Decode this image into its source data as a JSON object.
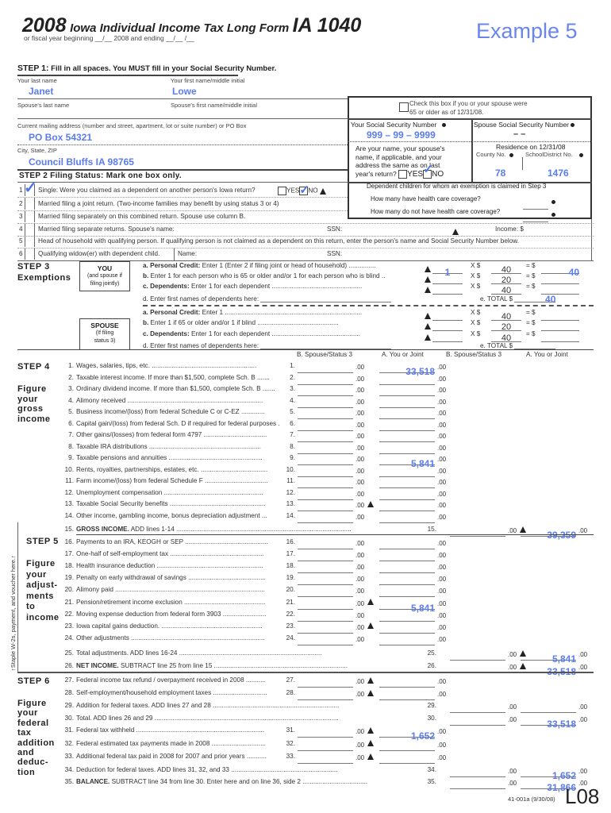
{
  "header": {
    "year": "2008",
    "title": "Iowa Individual Income Tax Long Form",
    "form": "IA 1040",
    "fiscal": "or fiscal year beginning __/__ 2008 and ending __/__ /__",
    "example": "Example 5"
  },
  "step1": {
    "title": "STEP 1:",
    "subtitle": "Fill in all spaces. You MUST fill in your Social Security Number.",
    "last_name_label": "Your last name",
    "last_name": "Janet",
    "first_name_label": "Your first name/middle initial",
    "first_name": "Lowe",
    "spouse_last_label": "Spouse's last name",
    "spouse_first_label": "Spouse's first name/middle initial",
    "address_label": "Current mailing address (number and street, apartment, lot or suite number) or PO Box",
    "address": "PO Box 54321",
    "city_label": "City, State, ZIP",
    "city": "Council Bluffs IA  98765",
    "age65_label_1": "Check this box if you or your spouse were",
    "age65_label_2": "65 or older as of 12/31/08.",
    "ssn_label": "Your Social Security Number",
    "ssn": "999 –  99  – 9999",
    "spouse_ssn_label": "Spouse Social Security Number",
    "spouse_ssn": "–        –",
    "same_q_1": "Are your name, your spouse's",
    "same_q_2": "name, if applicable, and your",
    "same_q_3": "address the same as on last",
    "same_q_4": "year's return?",
    "yes": "YES",
    "no": "NO",
    "residence_label": "Residence on 12/31/08",
    "county_label": "County No.",
    "school_label": "SchoolDistrict No.",
    "county": "78",
    "school": "1476",
    "dep_label": "Dependent children for whom an exemption is claimed in Step 3",
    "dep_q1": "How many have health care coverage?",
    "dep_q2": "How many do not have health care coverage?"
  },
  "step2": {
    "title": "STEP 2 Filing Status: Mark one box only.",
    "rows": [
      {
        "num": "1",
        "text": "Single: Were you claimed as a dependent on another person's Iowa return?",
        "checked": true
      },
      {
        "num": "2",
        "text": "Married filing a joint return. (Two-income families may benefit by using status 3 or 4)",
        "checked": false
      },
      {
        "num": "3",
        "text": "Married filing separately on this combined return. Spouse use column B.",
        "checked": false
      },
      {
        "num": "4",
        "text": "Married filing separate returns. Spouse's name:",
        "checked": false
      },
      {
        "num": "5",
        "text": "Head of household with qualifying person. If qualifying person is not claimed as a dependent on this return, enter the person's name and Social Security Number below.",
        "checked": false
      },
      {
        "num": "6",
        "text": "Qualifying widow(er) with dependent child.",
        "checked": false
      }
    ],
    "yes": "YES",
    "no": "NO",
    "ssn": "SSN:",
    "income": "Income: $",
    "name": "Name:"
  },
  "step3": {
    "title": "STEP 3",
    "subtitle": "Exemptions",
    "you_box": [
      "YOU",
      "(and spouse if",
      "filing jointly)"
    ],
    "spouse_box": [
      "SPOUSE",
      "(If filing",
      "status 3)"
    ],
    "you_rows": [
      {
        "label_b": "a. Personal Credit:",
        "label": " Enter 1 (Enter 2 if filing joint or head of household) ...............",
        "count": "1",
        "mult": "40",
        "result": "40"
      },
      {
        "label_b": "b.",
        "label": " Enter 1 for each person who is 65 or older  and/or 1 for each person who is blind ..",
        "count": "",
        "mult": "20",
        "result": ""
      },
      {
        "label_b": "c. Dependents:",
        "label": " Enter 1 for each dependent ..................................................",
        "count": "",
        "mult": "40",
        "result": ""
      }
    ],
    "you_d": "d. Enter first names of dependents here:",
    "you_total_label": "e. TOTAL $",
    "you_total": "40",
    "spouse_rows": [
      {
        "label_b": "a. Personal Credit:",
        "label": " Enter 1 ............................................................................",
        "mult": "40"
      },
      {
        "label_b": "b.",
        "label": " Enter 1 if 65 or older  and/or 1 if blind .............................................",
        "mult": "20"
      },
      {
        "label_b": "c. Dependents:",
        "label": " Enter 1 for each dependent .................................................",
        "mult": "40"
      }
    ],
    "spouse_d": "d. Enter first names of dependents here:",
    "spouse_total_label": "e. TOTAL $",
    "x": "X  $",
    "eq": "=  $"
  },
  "columns": {
    "b": "B. Spouse/Status 3",
    "a": "A. You or Joint"
  },
  "step4": {
    "title": "STEP 4",
    "subtitle": [
      "Figure",
      "your",
      "gross",
      "income"
    ],
    "lines": [
      {
        "n": "1.",
        "text": "Wages, salaries, tips, etc. ..........................................................",
        "ref": "1.",
        "b": "",
        "a": "33,518",
        "tri": false
      },
      {
        "n": "2.",
        "text": "Taxable interest income. If more than $1,500, complete Sch. B .......",
        "ref": "2.",
        "b": "",
        "a": "",
        "tri": false
      },
      {
        "n": "3.",
        "text": "Ordinary dividend income. If more than $1,500, complete Sch. B .......",
        "ref": "3.",
        "b": "",
        "a": "",
        "tri": false
      },
      {
        "n": "4.",
        "text": "Alimony received ...........................................................................",
        "ref": "4.",
        "b": "",
        "a": "",
        "tri": false
      },
      {
        "n": "5.",
        "text": "Business income/(loss) from federal Schedule C or C-EZ .............",
        "ref": "5.",
        "b": "",
        "a": "",
        "tri": false
      },
      {
        "n": "6.",
        "text": "Capital gain/(loss) from federal Sch. D if required for federal purposes .",
        "ref": "6.",
        "b": "",
        "a": "",
        "tri": false
      },
      {
        "n": "7.",
        "text": "Other gains/(losses) from federal form 4797 ...................................",
        "ref": "7.",
        "b": "",
        "a": "",
        "tri": false
      },
      {
        "n": "8.",
        "text": "Taxable IRA distributions ..............................................................",
        "ref": "8.",
        "b": "",
        "a": "",
        "tri": false
      },
      {
        "n": "9.",
        "text": "Taxable pensions and annuities ....................................................",
        "ref": "9.",
        "b": "",
        "a": "5,841",
        "tri": false
      },
      {
        "n": "10.",
        "text": "Rents, royalties, partnerships, estates, etc. .....................................",
        "ref": "10.",
        "b": "",
        "a": "",
        "tri": false
      },
      {
        "n": "11.",
        "text": "Farm income/(loss) from federal Schedule F ...................................",
        "ref": "11.",
        "b": "",
        "a": "",
        "tri": false
      },
      {
        "n": "12.",
        "text": "Unemployment compensation .......................................................",
        "ref": "12.",
        "b": "",
        "a": "",
        "tri": false
      },
      {
        "n": "13.",
        "text": "Taxable Social Security benefits .....................................................",
        "ref": "13.",
        "b": "",
        "a": "",
        "tri": true
      },
      {
        "n": "14.",
        "text": "Other income, gambling income, bonus depreciation adjustment ...",
        "ref": "14.",
        "b": "",
        "a": "",
        "tri": false
      }
    ],
    "line15": {
      "n": "15.",
      "bold": "GROSS INCOME.",
      "text": " ADD lines 1-14 .................................................................................................",
      "ref": "15.",
      "b": "",
      "a": "39,359"
    }
  },
  "staple": "Staple W-2s, payment, and voucher here.",
  "step5": {
    "title": "STEP 5",
    "subtitle": [
      "Figure",
      "your",
      "adjust-",
      "ments",
      "to",
      "income"
    ],
    "lines": [
      {
        "n": "16.",
        "text": "Payments to an IRA, KEOGH or SEP ..............................................",
        "ref": "16.",
        "b": "",
        "a": "",
        "tri": false
      },
      {
        "n": "17.",
        "text": "One-half of self-employment tax ....................................................",
        "ref": "17.",
        "b": "",
        "a": "",
        "tri": false
      },
      {
        "n": "18.",
        "text": "Health insurance deduction ...........................................................",
        "ref": "18.",
        "b": "",
        "a": "",
        "tri": false
      },
      {
        "n": "19.",
        "text": "Penalty on early withdrawal of savings ...........................................",
        "ref": "19.",
        "b": "",
        "a": "",
        "tri": false
      },
      {
        "n": "20.",
        "text": "Alimony paid ...................................................................................",
        "ref": "20.",
        "b": "",
        "a": "",
        "tri": false
      },
      {
        "n": "21.",
        "text": "Pension/retirement income exclusion .............................................",
        "ref": "21.",
        "b": "",
        "a": "5,841",
        "tri": true
      },
      {
        "n": "22.",
        "text": "Moving expense deduction from federal form 3903 ........................",
        "ref": "22.",
        "b": "",
        "a": "",
        "tri": false
      },
      {
        "n": "23.",
        "text": "Iowa capital gains deduction. ........................................................",
        "ref": "23.",
        "b": "",
        "a": "",
        "tri": true
      },
      {
        "n": "24.",
        "text": "Other adjustments ..........................................................................",
        "ref": "24.",
        "b": "",
        "a": "",
        "tri": false
      }
    ],
    "line25": {
      "n": "25.",
      "bold": "",
      "text": "Total adjustments. ADD lines 16-24 ...............................................................................",
      "ref": "25.",
      "b": "",
      "a": "5,841"
    },
    "line26": {
      "n": "26.",
      "bold": "NET INCOME.",
      "text": " SUBTRACT line 25 from line 15 ..........................................................................",
      "ref": "26.",
      "b": "",
      "a": "33,518"
    }
  },
  "step6": {
    "title": "STEP 6",
    "subtitle": [
      "Figure",
      "your",
      "federal",
      "tax",
      "addition",
      "and",
      "deduc-",
      "tion"
    ],
    "lines": [
      {
        "n": "27.",
        "text": "Federal income tax refund / overpayment received in 2008 ...........",
        "ref": "27.",
        "b": "",
        "a": "",
        "tri": true
      },
      {
        "n": "28.",
        "text": "Self-employment/household employment taxes ..............................",
        "ref": "28.",
        "b": "",
        "a": "",
        "tri": true
      }
    ],
    "line29": {
      "n": "29.",
      "bold": "",
      "text": "Addition for federal taxes. ADD lines 27 and 28 ......................................................................",
      "ref": "29.",
      "b": "",
      "a": ""
    },
    "line30": {
      "n": "30.",
      "bold": "",
      "text": "Total. ADD lines 26 and 29 ......................................................................................................",
      "ref": "30.",
      "b": "",
      "a": "33,518"
    },
    "lines2": [
      {
        "n": "31.",
        "text": "Federal tax withheld .......................................................................",
        "ref": "31.",
        "b": "",
        "a": "1,652",
        "tri": true
      },
      {
        "n": "32.",
        "text": "Federal estimated tax payments made in 2008 ..............................",
        "ref": "32.",
        "b": "",
        "a": "",
        "tri": true
      },
      {
        "n": "33.",
        "text": "Additional federal tax paid in 2008 for 2007 and prior years ...........",
        "ref": "33.",
        "b": "",
        "a": "",
        "tri": true
      }
    ],
    "line34": {
      "n": "34.",
      "bold": "",
      "text": "Deduction for federal taxes. ADD lines 31, 32, and 33 ...........................................................",
      "ref": "34.",
      "b": "",
      "a": "1,652"
    },
    "line35": {
      "n": "35.",
      "bold": "BALANCE.",
      "text": " SUBTRACT line 34 from line 30. Enter here and on line 36, side 2 ....................................",
      "ref": "35.",
      "b": "",
      "a": "31,866"
    }
  },
  "footer": {
    "code": "41-001a  (9/30/08)",
    "page": "L08"
  },
  "cents": ".00"
}
